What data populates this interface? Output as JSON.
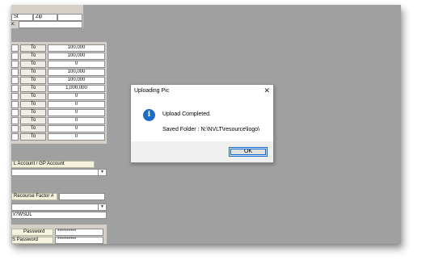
{
  "form": {
    "header_cells": [
      "St",
      "Zip"
    ],
    "header_second_label": "x:",
    "range_rows": [
      {
        "to_label": "To",
        "value": "100,000"
      },
      {
        "to_label": "To",
        "value": "100,000"
      },
      {
        "to_label": "To",
        "value": "0"
      },
      {
        "to_label": "To",
        "value": "100,000"
      },
      {
        "to_label": "To",
        "value": "100,000"
      },
      {
        "to_label": "To",
        "value": "1,000,000"
      },
      {
        "to_label": "To",
        "value": "0"
      },
      {
        "to_label": "To",
        "value": "0"
      },
      {
        "to_label": "To",
        "value": "0"
      },
      {
        "to_label": "To",
        "value": "0"
      },
      {
        "to_label": "To",
        "value": "0"
      },
      {
        "to_label": "To",
        "value": "0"
      }
    ],
    "account_label": "L Account / GP Account",
    "recourse_label": "Recourse Factor #",
    "wsdl_text": "x?WSDL",
    "password_label": "Password",
    "password_value": "**********",
    "s_password_label": "S Password",
    "s_password_value": "**********"
  },
  "dialog": {
    "title": "Uploading Pic",
    "close_glyph": "✕",
    "icon_glyph": "i",
    "message": "Upload Completed.",
    "folder_text": "Saved Folder : N:\\NVLT\\resource\\logo\\",
    "ok_label": "OK"
  },
  "colors": {
    "workspace": "#a0a0a0",
    "panel": "#d4d0c8",
    "info_icon": "#1a6ec9",
    "focus_border": "#0a6cd4"
  }
}
